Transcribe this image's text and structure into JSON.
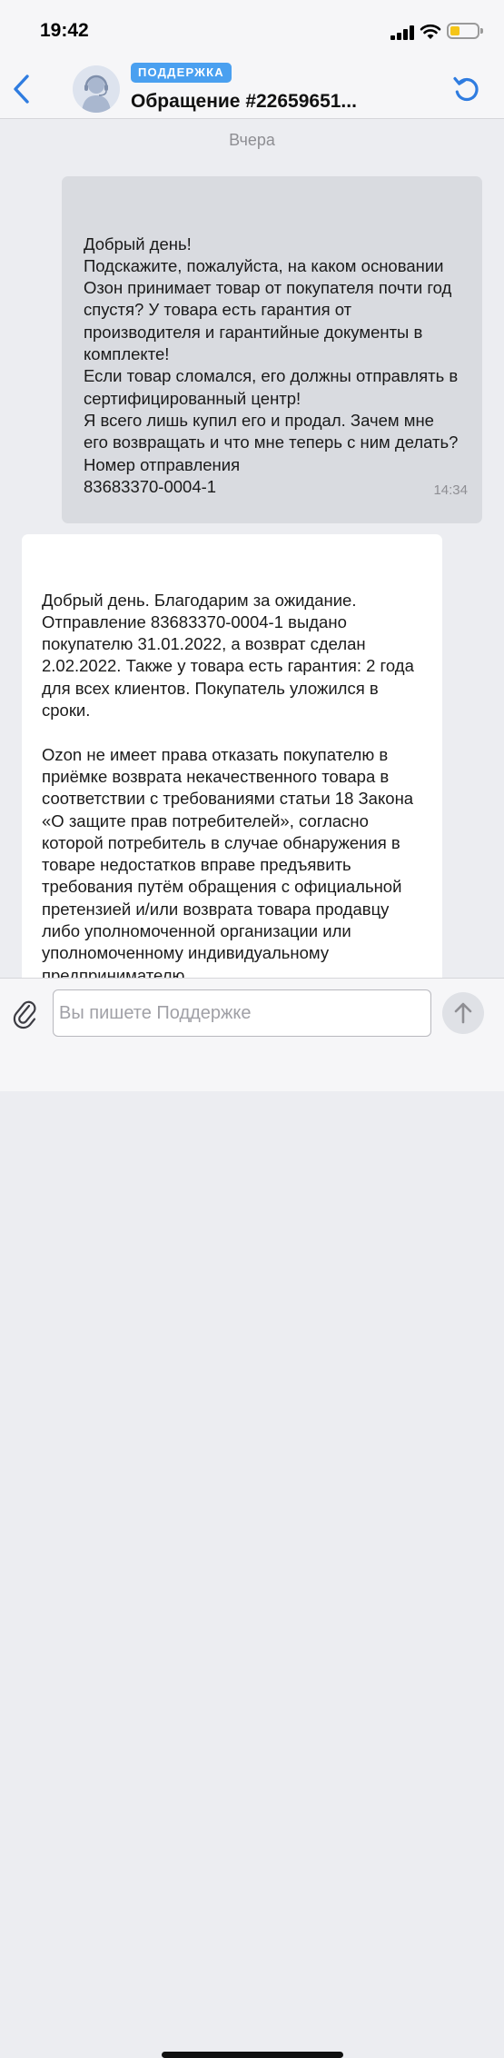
{
  "status_bar": {
    "time": "19:42"
  },
  "header": {
    "badge": "ПОДДЕРЖКА",
    "title": "Обращение #22659651...",
    "icons": {
      "back": "chevron-left-icon",
      "refresh": "refresh-icon",
      "avatar": "support-agent-avatar"
    }
  },
  "chat": {
    "day_label": "Вчера",
    "messages": [
      {
        "text": "Добрый день!\nПодскажите, пожалуйста, на каком основании Озон принимает товар от покупателя почти год спустя? У товара есть гарантия от производителя и гарантийные документы в комплекте!\nЕсли товар сломался, его должны отправлять в сертифицированный центр!\nЯ всего лишь купил его и продал. Зачем мне его возвращать и что мне теперь с ним делать?\nНомер отправления\n83683370-0004-1",
        "time": "14:34"
      },
      {
        "text": "Добрый день. Благодарим за ожидание. Отправление 83683370-0004-1 выдано покупателю 31.01.2022, а возврат сделан 2.02.2022. Также у товара есть гарантия: 2 года для всех клиентов. Покупатель уложился в сроки.\n\nOzon не имеет права отказать покупателю в приёмке возврата некачественного товара в соответствии с требованиями статьи 18 Закона «О защите прав потребителей», согласно которой потребитель в случае обнаружения в товаре недостатков вправе предъявить требования путём обращения с официальной претензией и/или возврата товара продавцу либо уполномоченной организации или уполномоченному индивидуальному предпринимателю."
      }
    ]
  },
  "composer": {
    "placeholder": "Вы пишете Поддержке",
    "value": "",
    "icons": {
      "attach": "paperclip-icon",
      "send": "arrow-up-icon"
    }
  },
  "colors": {
    "accent": "#2f7ce0",
    "badge": "#4aa0f0",
    "background": "#ecedf1",
    "outgoing_bubble": "#d9dbe0",
    "incoming_bubble": "#ffffff"
  }
}
